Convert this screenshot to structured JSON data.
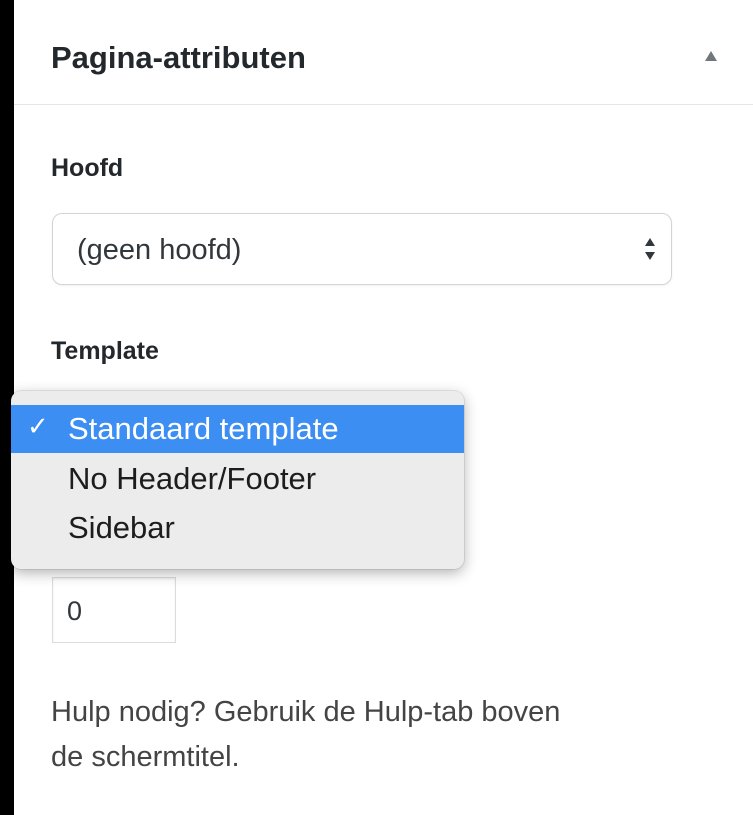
{
  "panel": {
    "title": "Pagina-attributen",
    "collapse_icon": "triangle-up-icon"
  },
  "parent": {
    "label": "Hoofd",
    "selected_value": "(geen hoofd)",
    "control_icon": "updown-arrows-icon"
  },
  "template": {
    "label": "Template",
    "options": [
      {
        "label": "Standaard template",
        "selected": true
      },
      {
        "label": "No Header/Footer",
        "selected": false
      },
      {
        "label": "Sidebar",
        "selected": false
      }
    ],
    "check_mark": "✓",
    "highlight_color": "#3d8ef2"
  },
  "order": {
    "value": "0"
  },
  "help": {
    "line1": "Hulp nodig? Gebruik de Hulp-tab boven",
    "line2": "de schermtitel."
  }
}
